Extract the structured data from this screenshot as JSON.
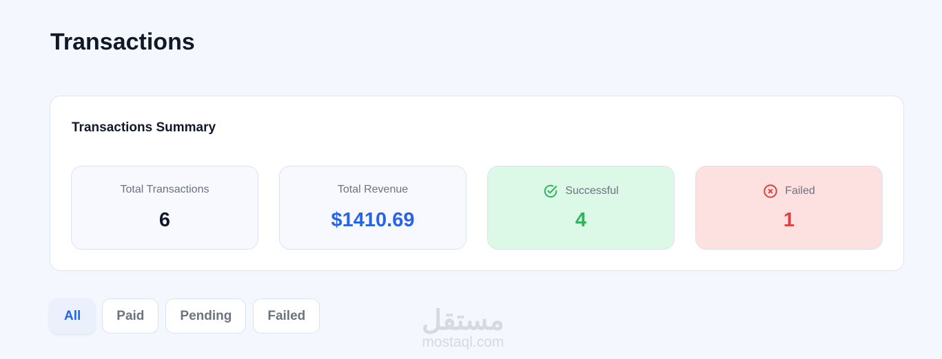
{
  "page": {
    "title": "Transactions"
  },
  "summary": {
    "title": "Transactions Summary",
    "total_transactions": {
      "label": "Total Transactions",
      "value": "6"
    },
    "total_revenue": {
      "label": "Total Revenue",
      "value": "$1410.69"
    },
    "successful": {
      "label": "Successful",
      "value": "4",
      "icon": "check-circle-icon"
    },
    "failed": {
      "label": "Failed",
      "value": "1",
      "icon": "x-circle-icon"
    }
  },
  "filters": {
    "items": [
      "All",
      "Paid",
      "Pending",
      "Failed"
    ],
    "active": "All"
  },
  "watermark": {
    "arabic": "مستقل",
    "latin": "mostaql.com"
  },
  "colors": {
    "accent": "#2563eb",
    "success": "#2fb45a",
    "danger": "#dc4040"
  }
}
